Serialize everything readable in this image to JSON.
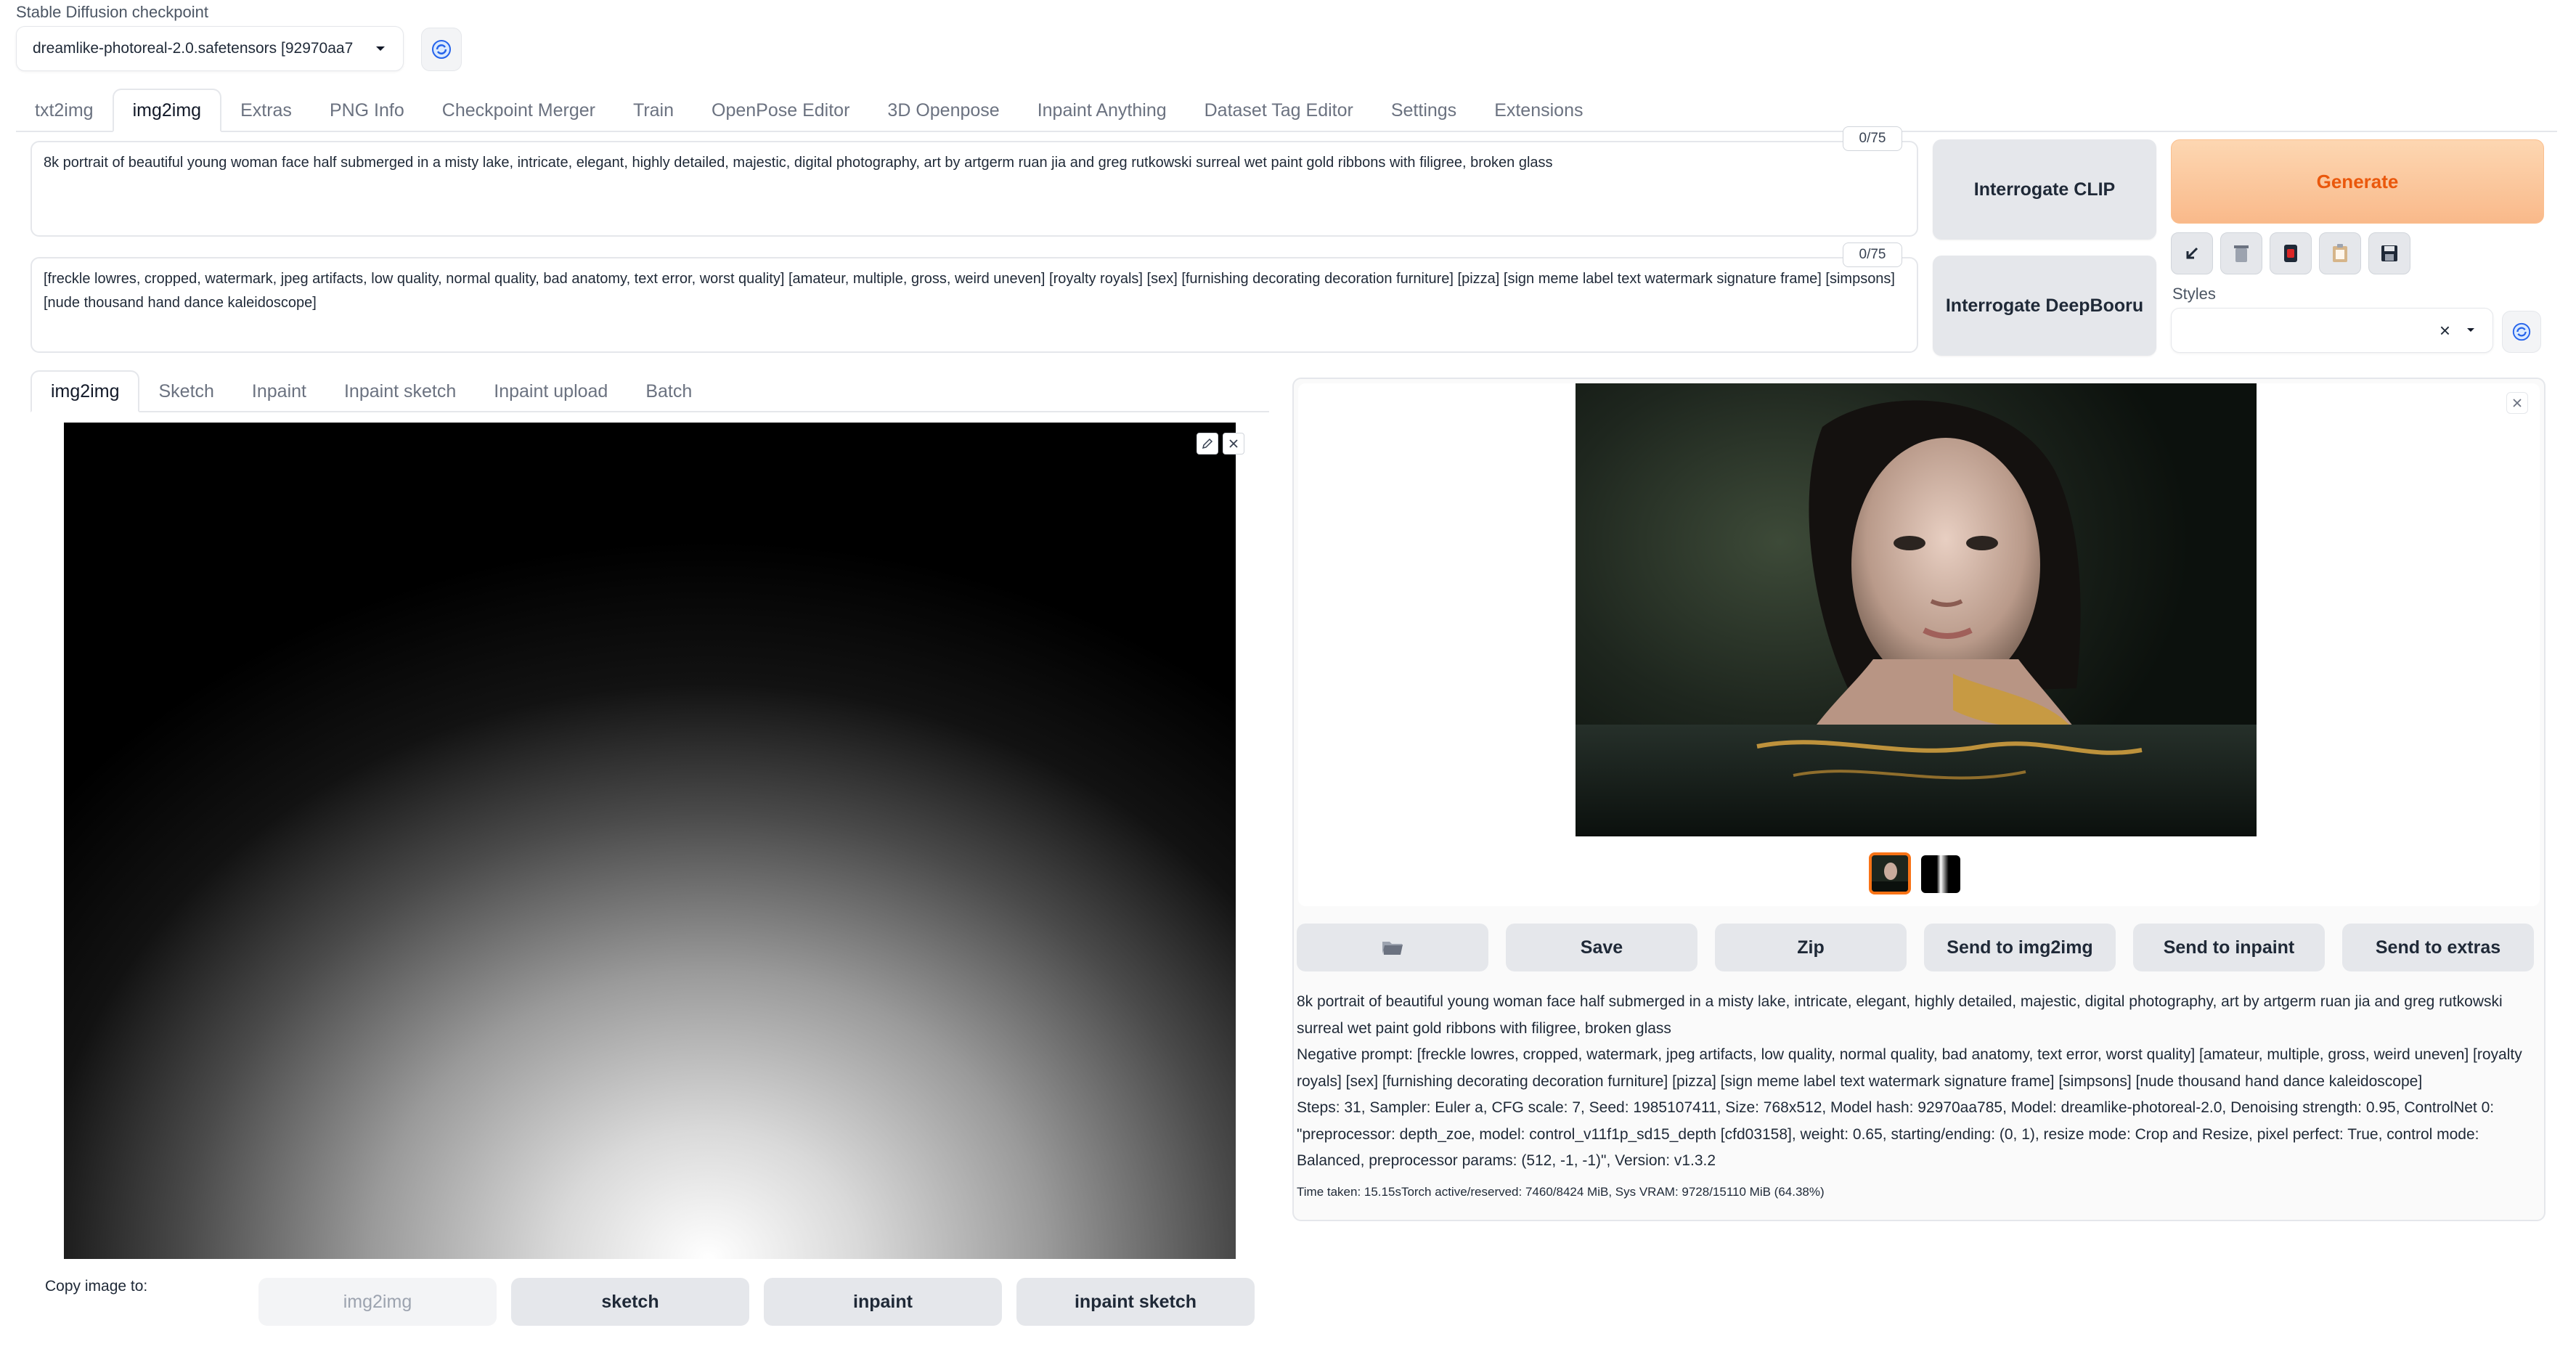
{
  "checkpoint": {
    "label": "Stable Diffusion checkpoint",
    "value": "dreamlike-photoreal-2.0.safetensors [92970aa7",
    "refresh_icon": "refresh-icon"
  },
  "main_tabs": [
    {
      "label": "txt2img",
      "active": false
    },
    {
      "label": "img2img",
      "active": true
    },
    {
      "label": "Extras",
      "active": false
    },
    {
      "label": "PNG Info",
      "active": false
    },
    {
      "label": "Checkpoint Merger",
      "active": false
    },
    {
      "label": "Train",
      "active": false
    },
    {
      "label": "OpenPose Editor",
      "active": false
    },
    {
      "label": "3D Openpose",
      "active": false
    },
    {
      "label": "Inpaint Anything",
      "active": false
    },
    {
      "label": "Dataset Tag Editor",
      "active": false
    },
    {
      "label": "Settings",
      "active": false
    },
    {
      "label": "Extensions",
      "active": false
    }
  ],
  "prompt": {
    "text": "8k portrait of beautiful young woman face half submerged in a misty lake, intricate, elegant, highly detailed, majestic, digital photography, art by artgerm ruan jia and greg rutkowski surreal wet paint gold ribbons with filigree, broken glass",
    "counter": "0/75"
  },
  "negative_prompt": {
    "text": "[freckle lowres, cropped, watermark, jpeg artifacts, low quality, normal quality, bad anatomy, text error, worst quality] [amateur, multiple, gross, weird uneven] [royalty royals] [sex] [furnishing decorating decoration furniture] [pizza] [sign meme label text watermark signature frame] [simpsons] [nude thousand hand dance kaleidoscope]",
    "counter": "0/75"
  },
  "interrogate": {
    "clip": "Interrogate CLIP",
    "deepbooru": "Interrogate DeepBooru"
  },
  "generate": {
    "label": "Generate",
    "color": "#f97316"
  },
  "tool_icons": [
    "arrow-down-left-icon",
    "trash-icon",
    "red-card-icon",
    "clipboard-icon",
    "save-disk-icon"
  ],
  "styles": {
    "label": "Styles",
    "clear_icon": "close-icon",
    "dropdown_icon": "chevron-down-icon",
    "refresh_icon": "refresh-icon"
  },
  "sub_tabs": [
    {
      "label": "img2img",
      "active": true
    },
    {
      "label": "Sketch",
      "active": false
    },
    {
      "label": "Inpaint",
      "active": false
    },
    {
      "label": "Inpaint sketch",
      "active": false
    },
    {
      "label": "Inpaint upload",
      "active": false
    },
    {
      "label": "Batch",
      "active": false
    }
  ],
  "input_image": {
    "edit_icon": "pencil-icon",
    "close_icon": "close-icon"
  },
  "copy_image": {
    "label": "Copy image to:",
    "buttons": [
      {
        "label": "img2img",
        "disabled": true
      },
      {
        "label": "sketch",
        "disabled": false
      },
      {
        "label": "inpaint",
        "disabled": false
      },
      {
        "label": "inpaint sketch",
        "disabled": false
      }
    ]
  },
  "gallery": {
    "close_icon": "close-icon",
    "thumbnails": [
      "generated-thumbnail",
      "depth-map-thumbnail"
    ]
  },
  "output_actions": {
    "folder_icon": "folder-icon",
    "buttons": [
      "Save",
      "Zip",
      "Send to img2img",
      "Send to inpaint",
      "Send to extras"
    ]
  },
  "generation_info": {
    "prompt": "8k portrait of beautiful young woman face half submerged in a misty lake, intricate, elegant, highly detailed, majestic, digital photography, art by artgerm ruan jia and greg rutkowski surreal wet paint gold ribbons with filigree, broken glass",
    "negative": "Negative prompt: [freckle lowres, cropped, watermark, jpeg artifacts, low quality, normal quality, bad anatomy, text error, worst quality] [amateur, multiple, gross, weird uneven] [royalty royals] [sex] [furnishing decorating decoration furniture] [pizza] [sign meme label text watermark signature frame] [simpsons] [nude thousand hand dance kaleidoscope]",
    "params": "Steps: 31, Sampler: Euler a, CFG scale: 7, Seed: 1985107411, Size: 768x512, Model hash: 92970aa785, Model: dreamlike-photoreal-2.0, Denoising strength: 0.95, ControlNet 0: \"preprocessor: depth_zoe, model: control_v11f1p_sd15_depth [cfd03158], weight: 0.65, starting/ending: (0, 1), resize mode: Crop and Resize, pixel perfect: True, control mode: Balanced, preprocessor params: (512, -1, -1)\", Version: v1.3.2",
    "time": "Time taken: 15.15sTorch active/reserved: 7460/8424 MiB, Sys VRAM: 9728/15110 MiB (64.38%)"
  }
}
